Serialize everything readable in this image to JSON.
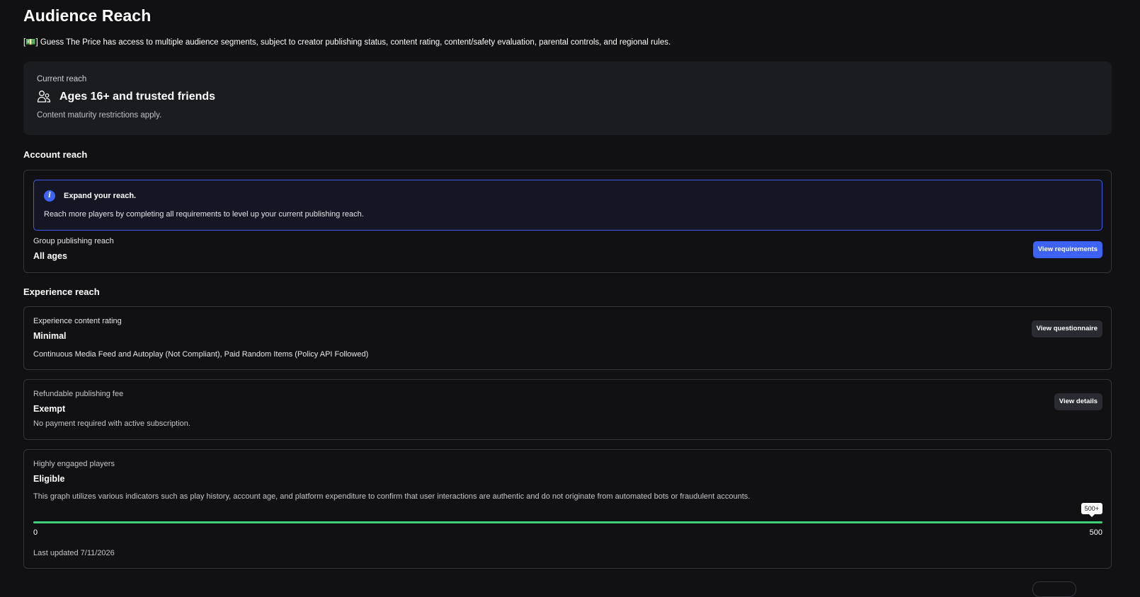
{
  "header": {
    "title": "Audience Reach",
    "intro": "[💵] Guess The Price has access to multiple audience segments, subject to creator publishing status, content rating, content/safety evaluation, parental controls, and regional rules."
  },
  "current_reach": {
    "label": "Current reach",
    "title": "Ages 16+ and trusted friends",
    "subtitle": "Content maturity restrictions apply."
  },
  "account_reach": {
    "heading": "Account reach",
    "notice_title": "Expand your reach.",
    "notice_text": "Reach more players by completing all requirements to level up your current publishing reach.",
    "label": "Group publishing reach",
    "value": "All ages",
    "button": "View requirements"
  },
  "experience_reach": {
    "heading": "Experience reach",
    "content_rating": {
      "label": "Experience content rating",
      "value": "Minimal",
      "description": "Continuous Media Feed and Autoplay (Not Compliant), Paid Random Items (Policy API Followed)",
      "button": "View questionnaire"
    },
    "publishing_fee": {
      "label": "Refundable publishing fee",
      "value": "Exempt",
      "description": "No payment required with active subscription.",
      "button": "View details"
    },
    "engaged_players": {
      "label": "Highly engaged players",
      "value": "Eligible",
      "description": "This graph utilizes various indicators such as play history, account age, and platform expenditure to confirm that user interactions are authentic and do not originate from automated bots or fraudulent accounts.",
      "min_label": "0",
      "max_label": "500",
      "tooltip": "500+",
      "progress_fraction": 1.0,
      "updated": "Last updated 7/11/2026"
    }
  },
  "colors": {
    "accent": "#3e62f5",
    "progress": "#3fcf7a",
    "background": "#111113"
  }
}
